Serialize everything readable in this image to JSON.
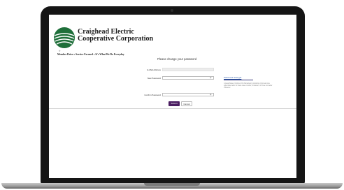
{
  "brand": {
    "line1": "Craighead Electric",
    "line2": "Cooperative Corporation",
    "reg_mark": "®"
  },
  "breadcrumb": "Member Drive  »  Service Focused  »  It's What We Do Everyday",
  "form": {
    "heading": "Please change your password",
    "email_label": "E-Mail Address",
    "email_value": "",
    "new_password_label": "New Password",
    "confirm_password_label": "Confirm Password",
    "requirements_link": "Password Strength",
    "requirements_note": "A passphrase (minimum 16 characters) consisting of at least one uppercase letter or lower-case number, character, or three non-letter character",
    "submit_label": "Submit",
    "cancel_label": "Cancel"
  },
  "colors": {
    "submit_button": "#4b1e62",
    "link": "#2b57a6",
    "logo_green": "#1f6f3a"
  },
  "icons": {
    "password_toggle": "eye-icon"
  }
}
